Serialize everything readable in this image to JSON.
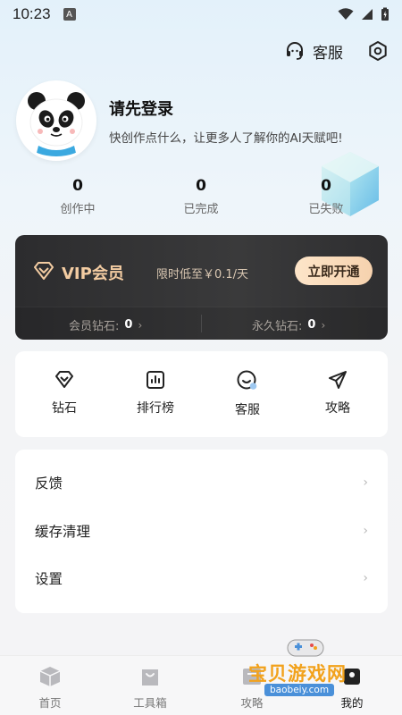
{
  "status_bar": {
    "time": "10:23",
    "notification_letter": "A"
  },
  "header": {
    "service_label": "客服"
  },
  "profile": {
    "name": "请先登录",
    "subtitle": "快创作点什么，让更多人了解你的AI天赋吧!"
  },
  "stats": [
    {
      "value": "0",
      "label": "创作中"
    },
    {
      "value": "0",
      "label": "已完成"
    },
    {
      "value": "0",
      "label": "已失败"
    }
  ],
  "vip": {
    "title": "VIP会员",
    "promo": "限时低至￥0.1/天",
    "button": "立即开通",
    "member_diamonds_label": "会员钻石:",
    "member_diamonds_value": "0",
    "permanent_diamonds_label": "永久钻石:",
    "permanent_diamonds_value": "0"
  },
  "quick_menu": [
    {
      "icon": "diamond-icon",
      "label": "钻石"
    },
    {
      "icon": "ranking-icon",
      "label": "排行榜"
    },
    {
      "icon": "service-icon",
      "label": "客服"
    },
    {
      "icon": "send-icon",
      "label": "攻略"
    }
  ],
  "settings_list": [
    {
      "label": "反馈"
    },
    {
      "label": "缓存清理"
    },
    {
      "label": "设置"
    }
  ],
  "bottom_nav": [
    {
      "icon": "home-icon",
      "label": "首页"
    },
    {
      "icon": "toolbox-icon",
      "label": "工具箱"
    },
    {
      "icon": "guide-icon",
      "label": "攻略"
    },
    {
      "icon": "mine-icon",
      "label": "我的"
    }
  ],
  "watermark": {
    "text": "宝贝游戏网",
    "url": "baobeiy.com"
  },
  "colors": {
    "vip_gold": "#f3cca2",
    "vip_card": "#2c2c2e",
    "accent_blue": "#4a90d9"
  }
}
